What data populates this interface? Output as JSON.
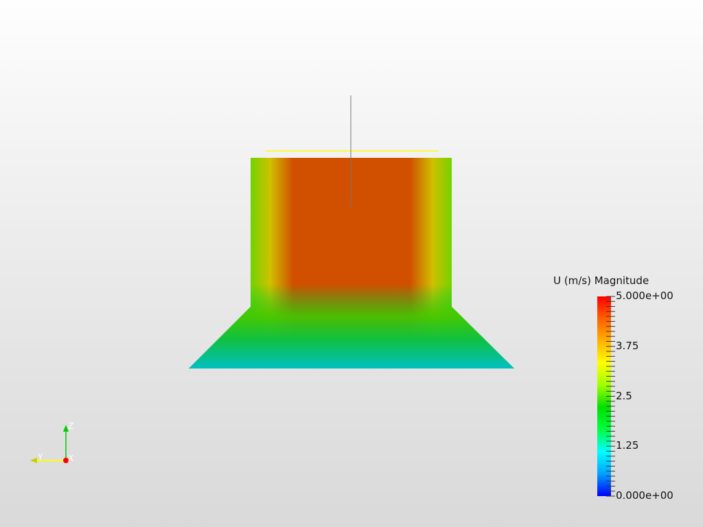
{
  "scalar_bar": {
    "title": "U (m/s) Magnitude",
    "range": [
      0,
      5
    ],
    "labels": [
      {
        "value": 5,
        "text": "5.000e+00"
      },
      {
        "value": 3.75,
        "text": "3.75"
      },
      {
        "value": 2.5,
        "text": "2.5"
      },
      {
        "value": 1.25,
        "text": "1.25"
      },
      {
        "value": 0,
        "text": "0.000e+00"
      }
    ],
    "colormap": [
      "#0000ff",
      "#00a0ff",
      "#00ffff",
      "#00ff40",
      "#00e000",
      "#a0ff00",
      "#ffff00",
      "#ffb000",
      "#ff6000",
      "#ff0000"
    ]
  },
  "axes": {
    "x": "X",
    "y": "Y",
    "z": "Z"
  },
  "colors": {
    "axis_x": "#ff0000",
    "axis_y": "#ffff00",
    "axis_z": "#00cc00",
    "probe_line": "#ffff00"
  }
}
